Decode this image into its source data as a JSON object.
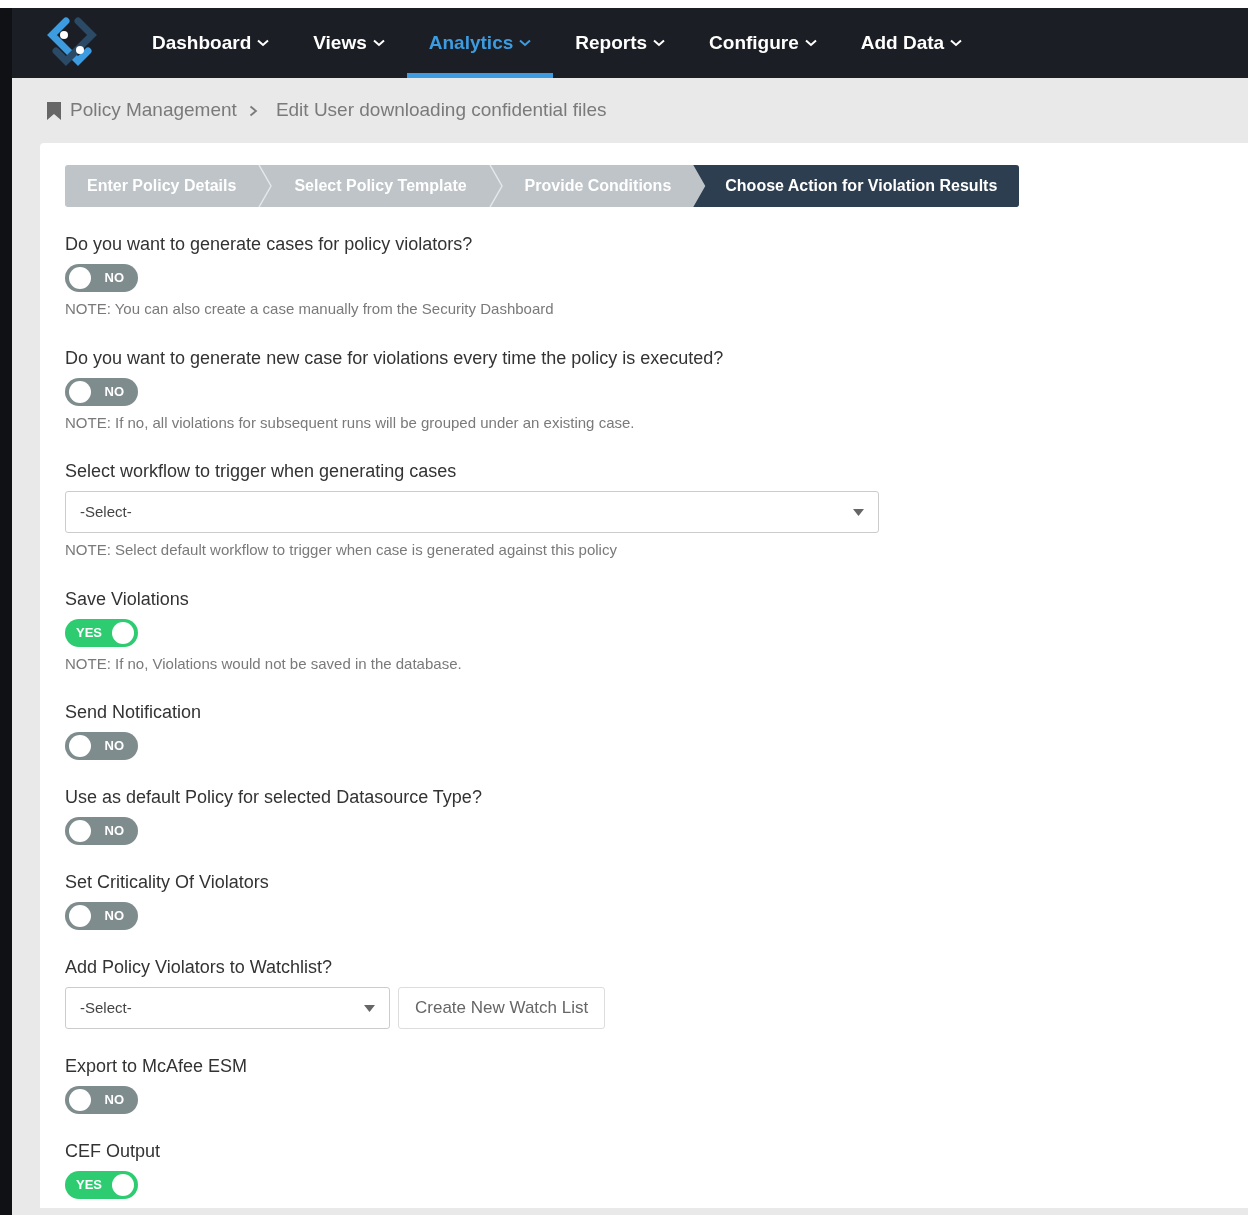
{
  "nav": {
    "items": [
      {
        "label": "Dashboard",
        "selected": false
      },
      {
        "label": "Views",
        "selected": false
      },
      {
        "label": "Analytics",
        "selected": true
      },
      {
        "label": "Reports",
        "selected": false
      },
      {
        "label": "Configure",
        "selected": false
      },
      {
        "label": "Add Data",
        "selected": false
      }
    ]
  },
  "breadcrumb": [
    "Policy Management",
    "Edit User downloading confidential files"
  ],
  "steps": [
    {
      "label": "Enter Policy Details",
      "selected": false
    },
    {
      "label": "Select Policy Template",
      "selected": false
    },
    {
      "label": "Provide Conditions",
      "selected": false
    },
    {
      "label": "Choose Action for Violation Results",
      "selected": true
    }
  ],
  "fields": [
    {
      "kind": "toggle",
      "label": "Do you want to generate cases for policy violators?",
      "on": false,
      "toggle_text": "NO",
      "note": "NOTE: You can also create a case manually from the Security Dashboard"
    },
    {
      "kind": "toggle",
      "label": "Do you want to generate new case for violations every time the policy is executed?",
      "on": false,
      "toggle_text": "NO",
      "note": "NOTE: If no, all violations for subsequent runs will be grouped under an existing case."
    },
    {
      "kind": "select",
      "label": "Select workflow to trigger when generating cases",
      "value": "-Select-",
      "note": "NOTE: Select default workflow to trigger when case is generated against this policy"
    },
    {
      "kind": "toggle",
      "label": "Save Violations",
      "on": true,
      "toggle_text": "YES",
      "note": "NOTE: If no, Violations would not be saved in the database."
    },
    {
      "kind": "toggle",
      "label": "Send Notification",
      "on": false,
      "toggle_text": "NO"
    },
    {
      "kind": "toggle",
      "label": "Use as default Policy for selected Datasource Type?",
      "on": false,
      "toggle_text": "NO"
    },
    {
      "kind": "toggle",
      "label": "Set Criticality Of Violators",
      "on": false,
      "toggle_text": "NO"
    },
    {
      "kind": "select_button",
      "label": "Add Policy Violators to Watchlist?",
      "value": "-Select-",
      "button": "Create New Watch List"
    },
    {
      "kind": "toggle",
      "label": "Export to McAfee ESM",
      "on": false,
      "toggle_text": "NO"
    },
    {
      "kind": "toggle",
      "label": "CEF Output",
      "on": true,
      "toggle_text": "YES"
    }
  ]
}
